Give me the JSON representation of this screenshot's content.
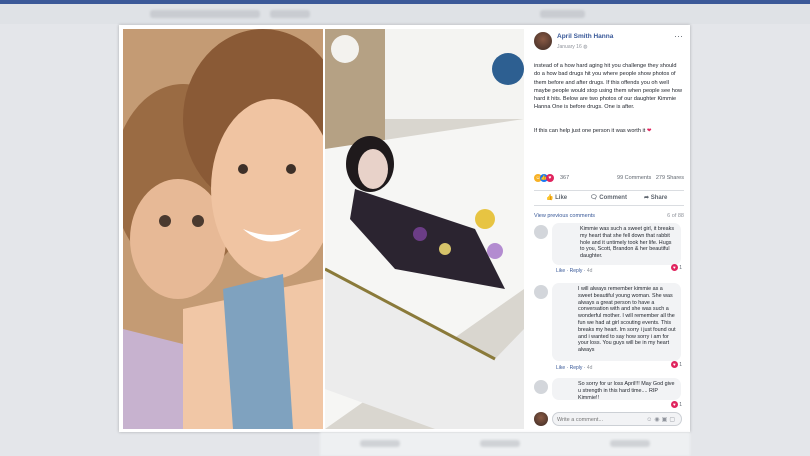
{
  "post": {
    "author": "April Smith Hanna",
    "date": "January 16",
    "body": "instead of a how hard aging hit you challenge they should do a how bad drugs hit you where people show photos of them before and after drugs. If this offends you oh well maybe people would stop using them when people see how hard it hits. Below are two photos of our daughter Kimmie Hanna One is before drugs. One is after.",
    "closing": "If this can help just one person it was worth it",
    "reaction_count": "367",
    "comments_count": "99 Comments",
    "shares_count": "279 Shares"
  },
  "actions": {
    "like": "Like",
    "comment": "Comment",
    "share": "Share"
  },
  "comments_header": {
    "view_previous": "View previous comments",
    "count": "6 of 88"
  },
  "comments": [
    {
      "text": "Kimmie was such a sweet girl, it breaks my heart that she fell down that rabbit hole and it untimely took her life. Hugs to you, Scott, Brandon & her beautiful daughter.",
      "like": "Like",
      "reply": "Reply",
      "time": "4d",
      "reactions": "1"
    },
    {
      "text": "I will always remember kimmie as a sweet beautiful young woman. She was always a great person to have a conversation with and she was such a wonderful mother. I will remember all the fun we had at girl scouting events. This breaks my heart. Im sorry i just found out and i wanted to say how sorry i am for your loss. You guys will be in my heart always",
      "like": "Like",
      "reply": "Reply",
      "time": "4d",
      "reactions": "1"
    },
    {
      "text": "So sorry for ur loss April!!! May God give u strength in this hard time.... RIP Kimmie!!",
      "like": "",
      "reply": "",
      "time": "",
      "reactions": "1"
    }
  ],
  "composer": {
    "placeholder": "Write a comment..."
  },
  "icons": [
    "more-icon",
    "globe-icon",
    "like-icon",
    "comment-icon",
    "share-icon",
    "emoji-icon",
    "camera-icon",
    "gif-icon",
    "sticker-icon"
  ],
  "colors": {
    "link": "#385898",
    "heart": "#e0245e",
    "like_blue": "#1877f2"
  }
}
